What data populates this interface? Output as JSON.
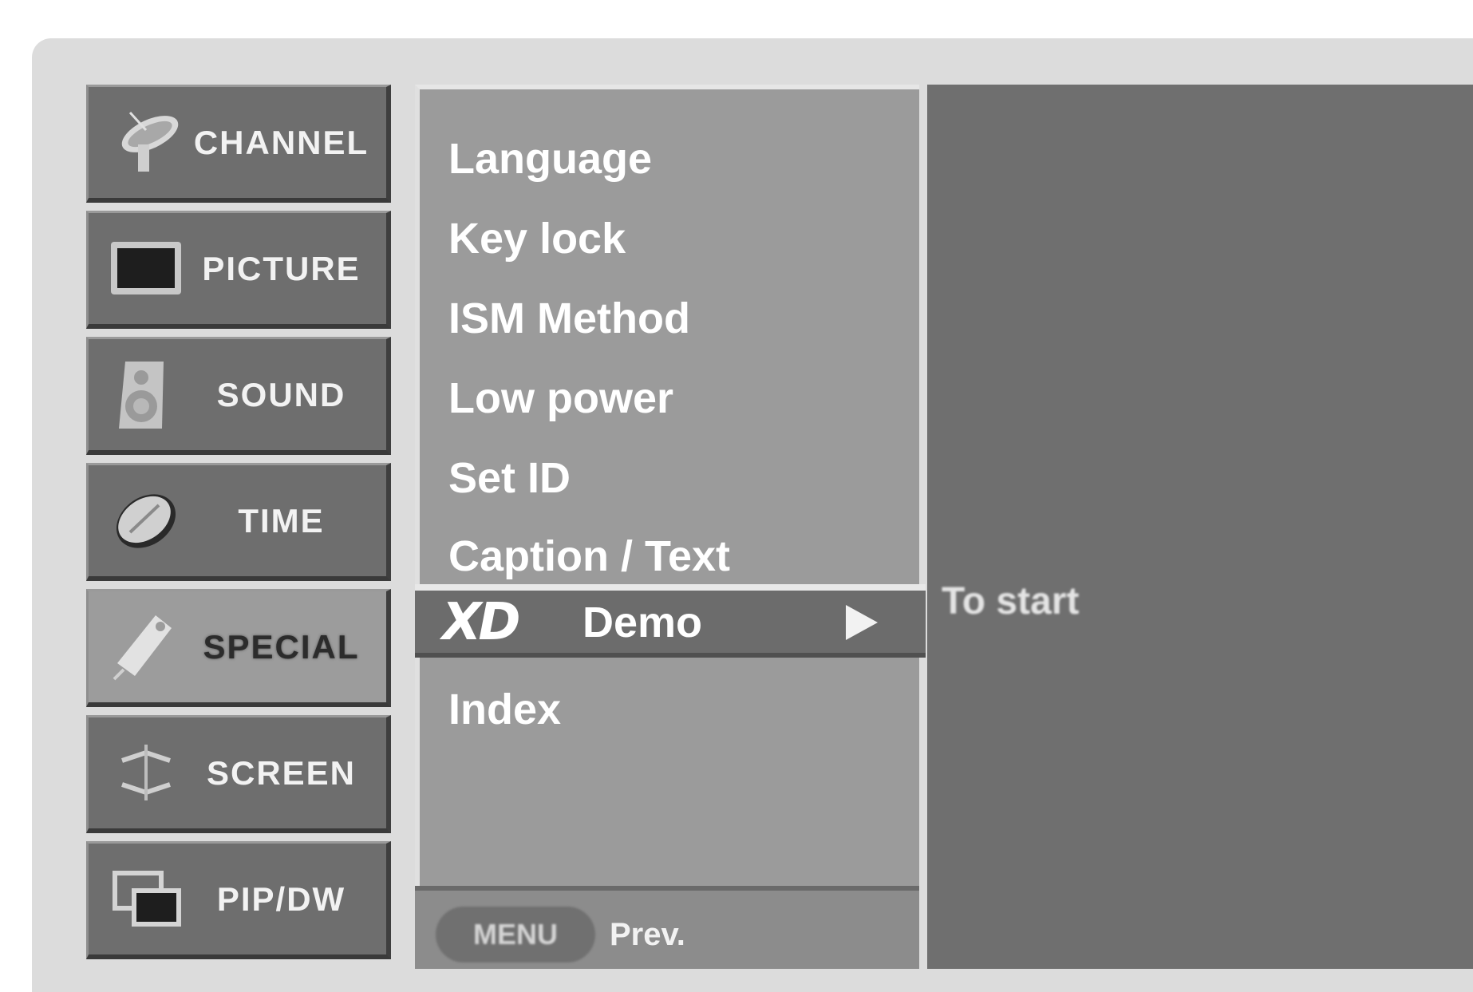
{
  "categories": [
    {
      "label": "CHANNEL",
      "icon": "satellite-dish-icon",
      "active": false
    },
    {
      "label": "PICTURE",
      "icon": "tv-screen-icon",
      "active": false
    },
    {
      "label": "SOUND",
      "icon": "speaker-icon",
      "active": false
    },
    {
      "label": "TIME",
      "icon": "clock-icon",
      "active": false
    },
    {
      "label": "SPECIAL",
      "icon": "tag-icon",
      "active": true
    },
    {
      "label": "SCREEN",
      "icon": "adjust-arrows-icon",
      "active": false
    },
    {
      "label": "PIP/DW",
      "icon": "pip-windows-icon",
      "active": false
    }
  ],
  "menu": {
    "items": [
      "Language",
      "Key lock",
      "ISM Method",
      "Low power",
      "Set ID",
      "Caption / Text"
    ],
    "selected": {
      "logo": "XD",
      "label": "Demo"
    },
    "after_items": [
      "Index"
    ],
    "footer": {
      "button_label": "MENU",
      "prev_label": "Prev."
    }
  },
  "info": {
    "text": "To start"
  },
  "colors": {
    "panel": "#6f6f6f",
    "menu": "#9b9b9b",
    "highlight": "#6c6c6c"
  }
}
